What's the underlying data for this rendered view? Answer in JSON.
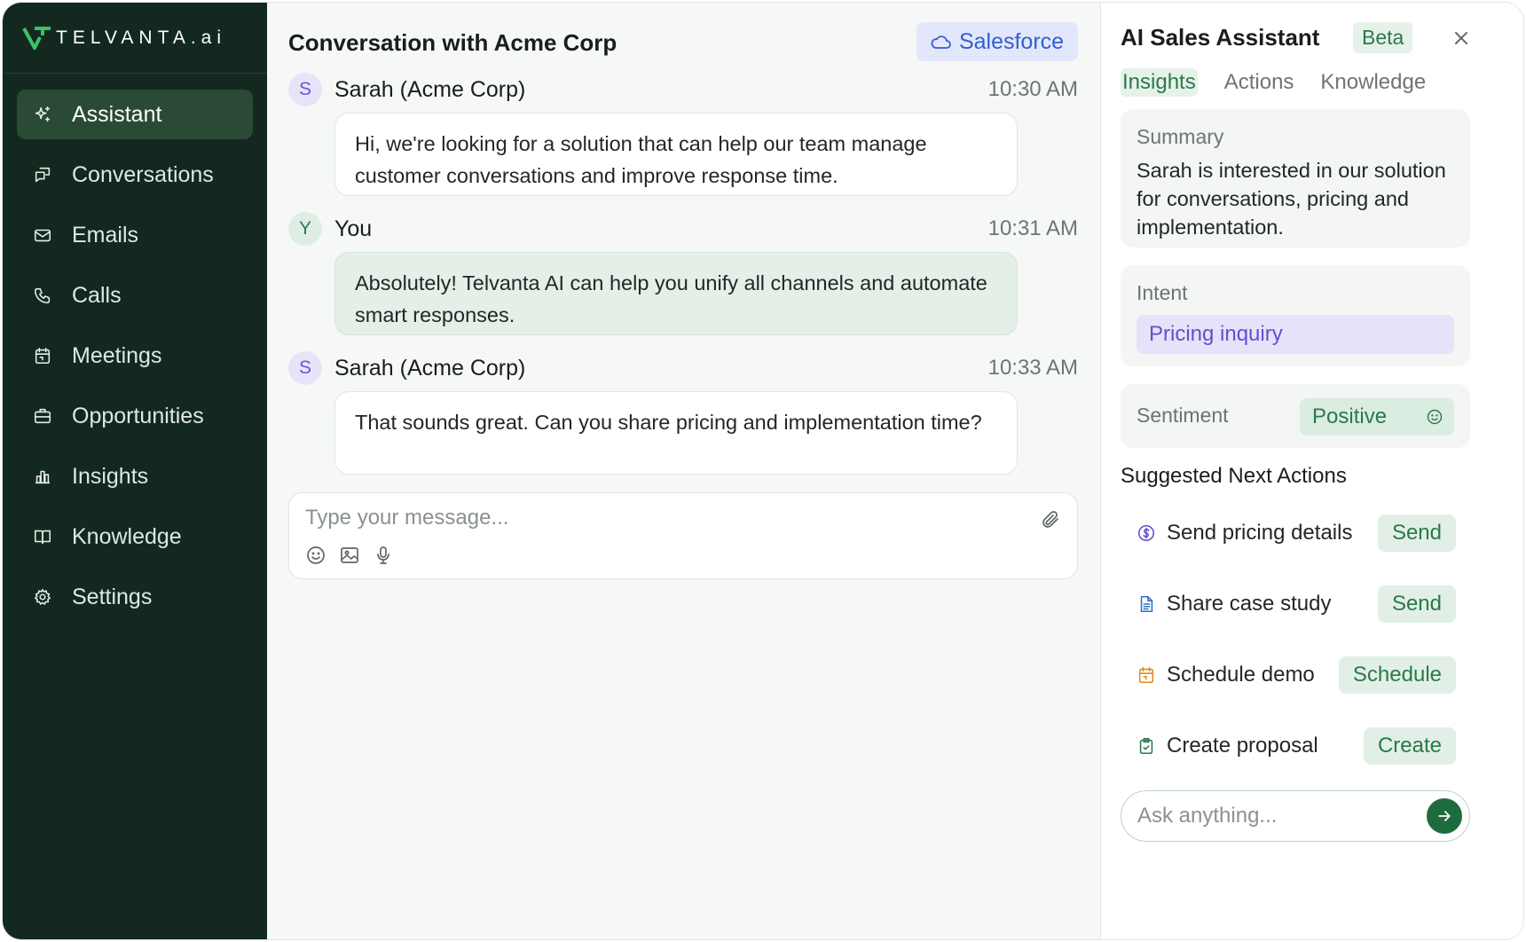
{
  "brand": {
    "name": "TELVANTA.ai"
  },
  "colors": {
    "sidebar_bg": "#13291f",
    "accent_green": "#1e6b3e",
    "intent_purple": "#6150d0"
  },
  "sidebar": {
    "items": [
      {
        "label": "Assistant",
        "icon": "sparkle-icon",
        "active": true
      },
      {
        "label": "Conversations",
        "icon": "chat-icon"
      },
      {
        "label": "Emails",
        "icon": "mail-icon"
      },
      {
        "label": "Calls",
        "icon": "phone-icon"
      },
      {
        "label": "Meetings",
        "icon": "calendar-icon"
      },
      {
        "label": "Opportunities",
        "icon": "briefcase-icon"
      },
      {
        "label": "Insights",
        "icon": "bar-chart-icon"
      },
      {
        "label": "Knowledge",
        "icon": "book-icon"
      },
      {
        "label": "Settings",
        "icon": "gear-icon"
      }
    ]
  },
  "conversation": {
    "title": "Conversation with Acme Corp",
    "crm_badge": "Salesforce",
    "messages": [
      {
        "avatar": "S",
        "sender": "Sarah (Acme Corp)",
        "time": "10:30 AM",
        "text": "Hi, we're looking for a solution that can help our team manage customer conversations and improve response time."
      },
      {
        "avatar": "Y",
        "sender": "You",
        "time": "10:31 AM",
        "text": "Absolutely! Telvanta AI can help you unify all channels and automate smart responses."
      },
      {
        "avatar": "S",
        "sender": "Sarah (Acme Corp)",
        "time": "10:33 AM",
        "text": "That sounds great. Can you share pricing and implementation time?"
      }
    ],
    "composer_placeholder": "Type your message..."
  },
  "assistant": {
    "title": "AI Sales Assistant",
    "badge": "Beta",
    "tabs": [
      "Insights",
      "Actions",
      "Knowledge"
    ],
    "active_tab": "Insights",
    "summary": {
      "label": "Summary",
      "text": "Sarah is interested in our solution for conversations, pricing and implementation."
    },
    "intent": {
      "label": "Intent",
      "value": "Pricing inquiry"
    },
    "sentiment": {
      "label": "Sentiment",
      "value": "Positive"
    },
    "next_actions_title": "Suggested Next Actions",
    "actions": [
      {
        "label": "Send pricing details",
        "button": "Send",
        "icon": "dollar-icon",
        "color": "#6150d0"
      },
      {
        "label": "Share case study",
        "button": "Send",
        "icon": "document-icon",
        "color": "#2f6fd0"
      },
      {
        "label": "Schedule demo",
        "button": "Schedule",
        "icon": "calendar-icon",
        "color": "#e08a1e"
      },
      {
        "label": "Create proposal",
        "button": "Create",
        "icon": "clipboard-check-icon",
        "color": "#2a7a4a"
      }
    ],
    "ask_placeholder": "Ask anything..."
  }
}
